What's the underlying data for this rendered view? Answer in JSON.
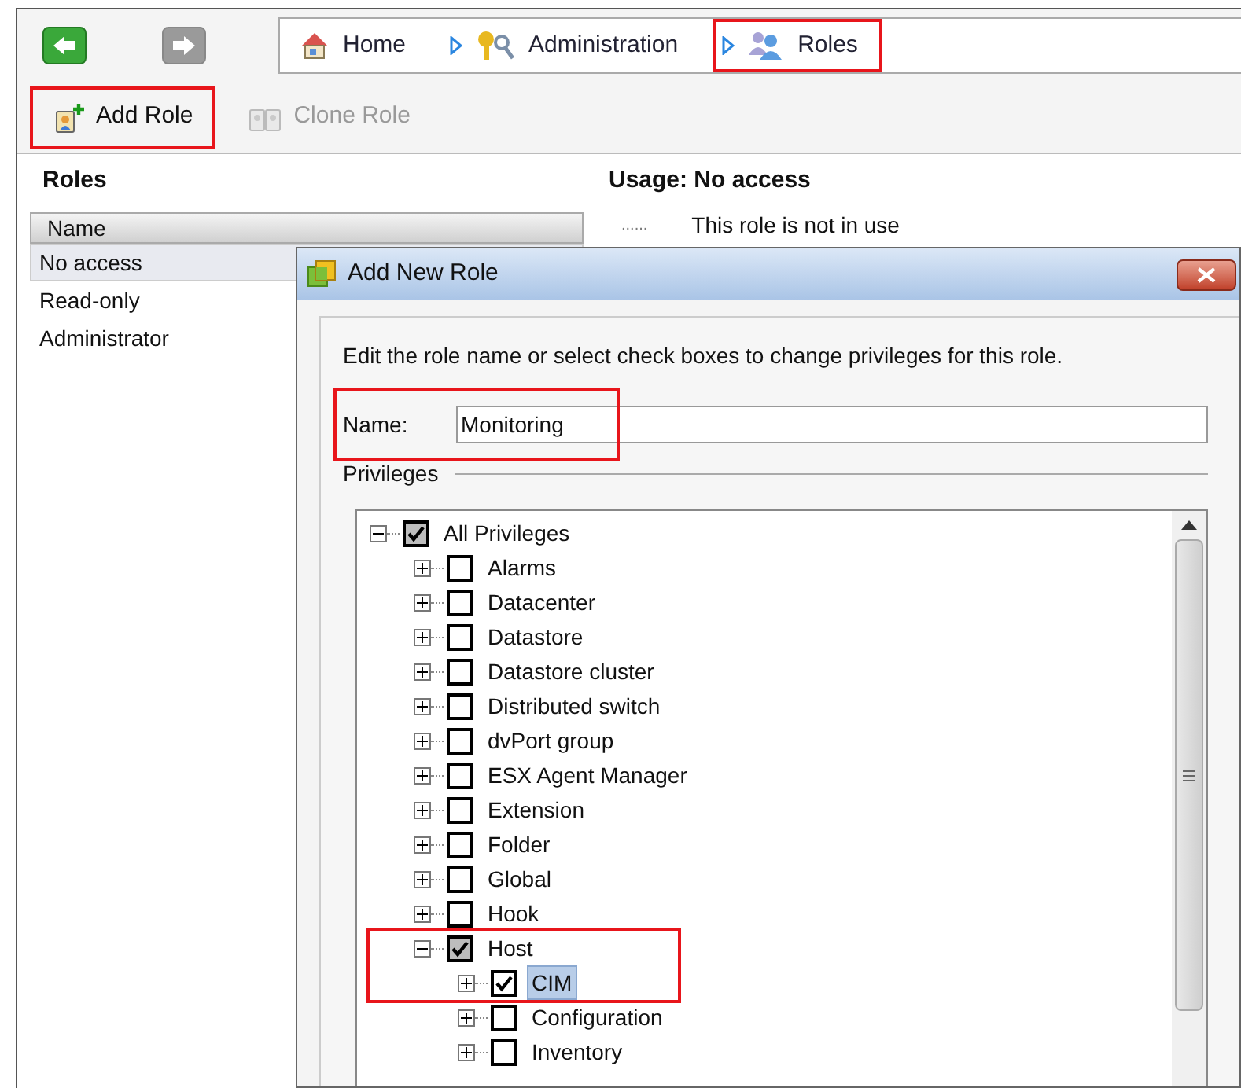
{
  "nav": {
    "back": {
      "disabled": false
    },
    "forward": {
      "disabled": true
    }
  },
  "breadcrumb": [
    {
      "label": "Home",
      "kind": "home",
      "highlighted": false
    },
    {
      "label": "Administration",
      "kind": "admin",
      "highlighted": false
    },
    {
      "label": "Roles",
      "kind": "roles",
      "highlighted": true
    }
  ],
  "toolbar": [
    {
      "label": "Add Role",
      "kind": "add",
      "disabled": false,
      "highlighted": true
    },
    {
      "label": "Clone Role",
      "kind": "clone",
      "disabled": true,
      "highlighted": false
    }
  ],
  "roles_panel": {
    "title": "Roles",
    "column": "Name",
    "items": [
      {
        "label": "No access",
        "selected": true
      },
      {
        "label": "Read-only",
        "selected": false
      },
      {
        "label": "Administrator",
        "selected": false
      }
    ]
  },
  "usage_panel": {
    "title": "Usage: No access",
    "rows": [
      {
        "dots": "......",
        "text": "This role is not in use"
      }
    ]
  },
  "dialog": {
    "title": "Add New Role",
    "instructions": "Edit the role name or select check boxes to change privileges for this role.",
    "name_field": {
      "label": "Name:",
      "value": "Monitoring",
      "highlighted": true
    },
    "privileges_label": "Privileges",
    "tree": [
      {
        "label": "All Privileges",
        "checked": true,
        "mixed": true,
        "expanded": true,
        "selected": false,
        "highlighted": false,
        "children": [
          {
            "label": "Alarms",
            "checked": false,
            "mixed": false,
            "expanded": false,
            "selected": false,
            "highlighted": false
          },
          {
            "label": "Datacenter",
            "checked": false,
            "mixed": false,
            "expanded": false,
            "selected": false,
            "highlighted": false
          },
          {
            "label": "Datastore",
            "checked": false,
            "mixed": false,
            "expanded": false,
            "selected": false,
            "highlighted": false
          },
          {
            "label": "Datastore cluster",
            "checked": false,
            "mixed": false,
            "expanded": false,
            "selected": false,
            "highlighted": false
          },
          {
            "label": "Distributed switch",
            "checked": false,
            "mixed": false,
            "expanded": false,
            "selected": false,
            "highlighted": false
          },
          {
            "label": "dvPort group",
            "checked": false,
            "mixed": false,
            "expanded": false,
            "selected": false,
            "highlighted": false
          },
          {
            "label": "ESX Agent Manager",
            "checked": false,
            "mixed": false,
            "expanded": false,
            "selected": false,
            "highlighted": false
          },
          {
            "label": "Extension",
            "checked": false,
            "mixed": false,
            "expanded": false,
            "selected": false,
            "highlighted": false
          },
          {
            "label": "Folder",
            "checked": false,
            "mixed": false,
            "expanded": false,
            "selected": false,
            "highlighted": false
          },
          {
            "label": "Global",
            "checked": false,
            "mixed": false,
            "expanded": false,
            "selected": false,
            "highlighted": false
          },
          {
            "label": "Hook",
            "checked": false,
            "mixed": false,
            "expanded": false,
            "selected": false,
            "highlighted": false
          },
          {
            "label": "Host",
            "checked": true,
            "mixed": true,
            "expanded": true,
            "selected": false,
            "highlighted": true,
            "children": [
              {
                "label": "CIM",
                "checked": true,
                "mixed": false,
                "expanded": false,
                "selected": true,
                "highlighted": true
              },
              {
                "label": "Configuration",
                "checked": false,
                "mixed": false,
                "expanded": false,
                "selected": false,
                "highlighted": false
              },
              {
                "label": "Inventory",
                "checked": false,
                "mixed": false,
                "expanded": false,
                "selected": false,
                "highlighted": false
              }
            ]
          }
        ]
      }
    ]
  }
}
